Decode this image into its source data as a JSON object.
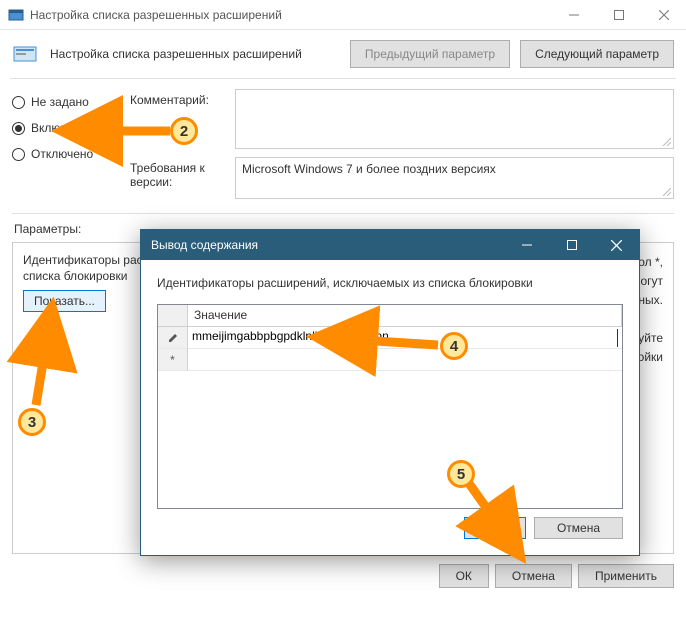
{
  "window": {
    "title": "Настройка списка разрешенных расширений",
    "header_title": "Настройка списка разрешенных расширений",
    "prev_btn": "Предыдущий параметр",
    "next_btn": "Следующий параметр"
  },
  "radios": {
    "not_configured": "Не задано",
    "enabled": "Включено",
    "disabled": "Отключено"
  },
  "meta": {
    "comment_label": "Комментарий:",
    "requirement_label": "Требования к версии:",
    "requirement_value": "Microsoft Windows 7 и более поздних версиях"
  },
  "params": {
    "section_label": "Параметры:",
    "box_label": "Идентификаторы расширений, исключаемых из списка блокировки",
    "show_btn": "Показать..."
  },
  "desc": {
    "line1": "символ *,",
    "line2": "могут",
    "line3": "енных.",
    "line4": "льзуйте",
    "line5": "стройки"
  },
  "footer": {
    "ok": "ОК",
    "cancel": "Отмена",
    "apply": "Применить"
  },
  "dialog": {
    "title": "Вывод содержания",
    "label": "Идентификаторы расширений, исключаемых из списка блокировки",
    "col_header": "Значение",
    "row1_value": "mmeijimgabbpbgpdklnllpncmdofkcpn",
    "row_marker_edit": "✎",
    "row_marker_new": "*",
    "ok": "ОК",
    "cancel": "Отмена"
  },
  "callouts": {
    "c2": "2",
    "c3": "3",
    "c4": "4",
    "c5": "5"
  }
}
